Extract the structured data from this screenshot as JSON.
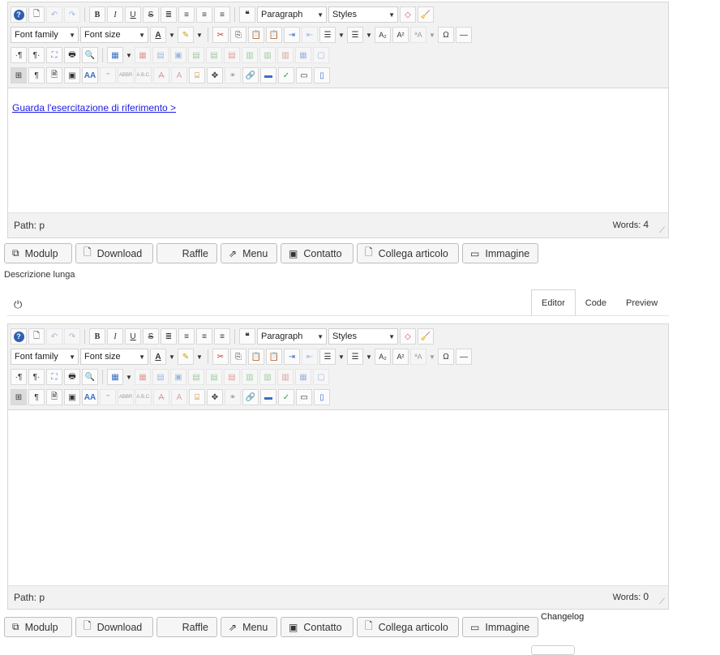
{
  "toolbar": {
    "format_select": "Paragraph",
    "styles_select": "Styles",
    "font_family_select": "Font family",
    "font_size_select": "Font size"
  },
  "editor1": {
    "link_text": "Guarda l'esercitazione di riferimento >",
    "path_label": "Path: p",
    "words_label": "Words:",
    "words_count": "4"
  },
  "buttons": {
    "modulp": "Modulp",
    "download": "Download",
    "raffle": "Raffle",
    "menu": "Menu",
    "contatto": "Contatto",
    "collega": "Collega articolo",
    "immagine": "Immagine"
  },
  "description_label": "Descrizione lunga",
  "tabs": [
    "Editor",
    "Code",
    "Preview"
  ],
  "editor2": {
    "path_label": "Path: p",
    "words_label": "Words:",
    "words_count": "0"
  },
  "changelog_label": "Changelog"
}
